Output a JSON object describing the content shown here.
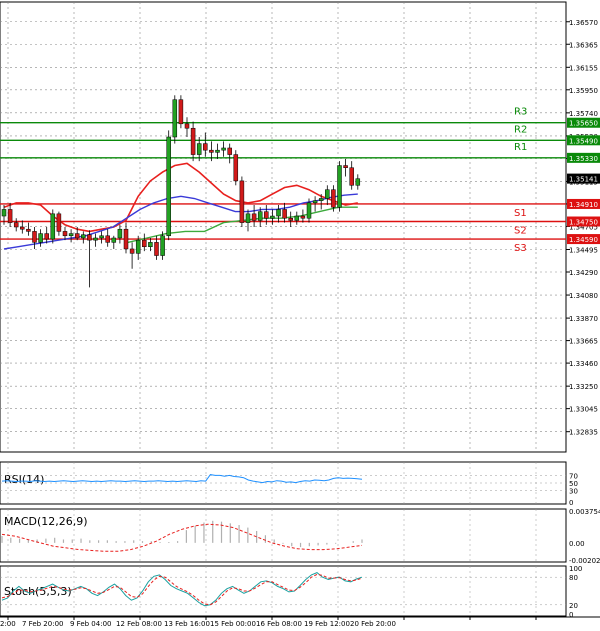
{
  "chart_data": {
    "type": "candlestick",
    "price_axis": {
      "ylim": [
        1.3265,
        1.3675
      ],
      "ticks": [
        "1.36570",
        "1.36365",
        "1.36155",
        "1.35950",
        "1.35740",
        "1.35530",
        "1.35325",
        "1.35115",
        "1.34910",
        "1.34705",
        "1.34495",
        "1.34290",
        "1.34080",
        "1.33870",
        "1.33665",
        "1.33460",
        "1.33250",
        "1.33045",
        "1.32835"
      ]
    },
    "x_tick_labels": [
      "2:00",
      "7 Feb 20:00",
      "9 Feb 04:00",
      "12 Feb 08:00",
      "13 Feb 16:00",
      "15 Feb 00:00",
      "16 Feb 08:00",
      "19 Feb 12:00",
      "20 Feb 20:00"
    ],
    "levels": [
      {
        "name": "R3",
        "value": "1.35650",
        "color": "#0a8a0a"
      },
      {
        "name": "R2",
        "value": "1.35490",
        "color": "#0a8a0a"
      },
      {
        "name": "R1",
        "value": "1.35330",
        "color": "#0a8a0a"
      },
      {
        "name": "S1",
        "value": "1.34910",
        "color": "#dd1111"
      },
      {
        "name": "S2",
        "value": "1.34750",
        "color": "#dd1111"
      },
      {
        "name": "S3",
        "value": "1.34590",
        "color": "#dd1111"
      }
    ],
    "current_price": "1.35141",
    "candles": [
      [
        1.348,
        1.349,
        1.3472,
        1.3486
      ],
      [
        1.3486,
        1.3492,
        1.347,
        1.3474
      ],
      [
        1.3474,
        1.3478,
        1.3466,
        1.347
      ],
      [
        1.347,
        1.3476,
        1.3464,
        1.3468
      ],
      [
        1.3468,
        1.3474,
        1.3462,
        1.3466
      ],
      [
        1.3466,
        1.347,
        1.345,
        1.3456
      ],
      [
        1.3456,
        1.3468,
        1.3452,
        1.3464
      ],
      [
        1.3464,
        1.347,
        1.3455,
        1.3459
      ],
      [
        1.3459,
        1.3486,
        1.3455,
        1.3482
      ],
      [
        1.3482,
        1.3484,
        1.3462,
        1.3466
      ],
      [
        1.3466,
        1.347,
        1.3458,
        1.3462
      ],
      [
        1.3462,
        1.3468,
        1.3456,
        1.3464
      ],
      [
        1.3464,
        1.347,
        1.3458,
        1.346
      ],
      [
        1.346,
        1.3466,
        1.3455,
        1.3463
      ],
      [
        1.3463,
        1.3467,
        1.3415,
        1.3458
      ],
      [
        1.3458,
        1.3464,
        1.3452,
        1.346
      ],
      [
        1.346,
        1.3466,
        1.3455,
        1.3462
      ],
      [
        1.3462,
        1.3468,
        1.3452,
        1.3456
      ],
      [
        1.3456,
        1.3462,
        1.345,
        1.346
      ],
      [
        1.346,
        1.3472,
        1.3455,
        1.3468
      ],
      [
        1.3468,
        1.3474,
        1.3446,
        1.345
      ],
      [
        1.345,
        1.3456,
        1.3432,
        1.3446
      ],
      [
        1.3446,
        1.3462,
        1.344,
        1.3458
      ],
      [
        1.3458,
        1.3464,
        1.3448,
        1.3452
      ],
      [
        1.3452,
        1.346,
        1.3448,
        1.3456
      ],
      [
        1.3456,
        1.3462,
        1.344,
        1.3444
      ],
      [
        1.3444,
        1.3466,
        1.344,
        1.3462
      ],
      [
        1.3462,
        1.3558,
        1.3458,
        1.3552
      ],
      [
        1.3552,
        1.359,
        1.3546,
        1.3586
      ],
      [
        1.3586,
        1.359,
        1.356,
        1.3564
      ],
      [
        1.3564,
        1.357,
        1.3552,
        1.356
      ],
      [
        1.356,
        1.3566,
        1.353,
        1.3536
      ],
      [
        1.3536,
        1.3552,
        1.353,
        1.3546
      ],
      [
        1.3546,
        1.3556,
        1.3534,
        1.354
      ],
      [
        1.354,
        1.3548,
        1.353,
        1.3538
      ],
      [
        1.3538,
        1.3546,
        1.3532,
        1.354
      ],
      [
        1.354,
        1.3548,
        1.3534,
        1.3542
      ],
      [
        1.3542,
        1.3546,
        1.3528,
        1.3536
      ],
      [
        1.3536,
        1.354,
        1.3508,
        1.3512
      ],
      [
        1.3512,
        1.3516,
        1.347,
        1.3474
      ],
      [
        1.3474,
        1.3486,
        1.3466,
        1.3482
      ],
      [
        1.3482,
        1.349,
        1.347,
        1.3476
      ],
      [
        1.3476,
        1.3488,
        1.347,
        1.3484
      ],
      [
        1.3484,
        1.349,
        1.3472,
        1.3478
      ],
      [
        1.3478,
        1.3486,
        1.3472,
        1.348
      ],
      [
        1.348,
        1.349,
        1.3474,
        1.3486
      ],
      [
        1.3486,
        1.3492,
        1.3474,
        1.3478
      ],
      [
        1.3478,
        1.3484,
        1.347,
        1.3476
      ],
      [
        1.3476,
        1.3484,
        1.3472,
        1.348
      ],
      [
        1.348,
        1.3486,
        1.3474,
        1.3478
      ],
      [
        1.3478,
        1.3496,
        1.3474,
        1.3492
      ],
      [
        1.3492,
        1.3498,
        1.3484,
        1.3494
      ],
      [
        1.3494,
        1.35,
        1.3486,
        1.3496
      ],
      [
        1.3496,
        1.3508,
        1.349,
        1.3504
      ],
      [
        1.3504,
        1.3508,
        1.3484,
        1.3488
      ],
      [
        1.3488,
        1.353,
        1.3484,
        1.3526
      ],
      [
        1.3526,
        1.3532,
        1.3516,
        1.3524
      ],
      [
        1.3524,
        1.353,
        1.3504,
        1.3508
      ],
      [
        1.3508,
        1.3518,
        1.3504,
        1.3514
      ]
    ],
    "moving_averages": [
      {
        "color": "#e8201e",
        "values": [
          1.3488,
          1.3492,
          1.3492,
          1.349,
          1.348,
          1.3472,
          1.3468,
          1.3466,
          1.3468,
          1.347,
          1.3476,
          1.3498,
          1.3512,
          1.352,
          1.3526,
          1.3528,
          1.352,
          1.351,
          1.35,
          1.3494,
          1.3492,
          1.3494,
          1.35,
          1.3506,
          1.3508,
          1.3504,
          1.3498,
          1.3494,
          1.349,
          1.3492
        ]
      },
      {
        "color": "#3a3ad8",
        "values": [
          1.345,
          1.3452,
          1.3454,
          1.3456,
          1.3458,
          1.346,
          1.3462,
          1.3466,
          1.347,
          1.3478,
          1.3486,
          1.3492,
          1.3496,
          1.3498,
          1.3496,
          1.3492,
          1.3488,
          1.3484,
          1.3484,
          1.3486,
          1.3486,
          1.3488,
          1.3492,
          1.3494,
          1.3497,
          1.3499,
          1.35
        ]
      },
      {
        "color": "#3caa3c",
        "values": [
          1.3456,
          1.346,
          1.3464,
          1.3466,
          1.3466,
          1.3474,
          1.3476,
          1.3478,
          1.3478,
          1.348,
          1.3484,
          1.3488,
          1.3488
        ]
      }
    ],
    "panels": [
      {
        "label": "RSI(14)",
        "ticks": [
          "70",
          "50",
          "30",
          "0"
        ],
        "range": [
          0,
          100
        ],
        "values": [
          55,
          56,
          55,
          54,
          55,
          55,
          54,
          56,
          55,
          54,
          55,
          54,
          55,
          56,
          55,
          54,
          55,
          56,
          55,
          54,
          55,
          54,
          55,
          56,
          55,
          55,
          54,
          55,
          56,
          55,
          54,
          55,
          55,
          56,
          55,
          54,
          55,
          54,
          55,
          56,
          55,
          54,
          56,
          55,
          72,
          70,
          70,
          68,
          70,
          67,
          66,
          64,
          58,
          55,
          53,
          51,
          54,
          53,
          56,
          55,
          52,
          53,
          51,
          54,
          56,
          55,
          58,
          57,
          56,
          58,
          62,
          64,
          62,
          63,
          62,
          61,
          60
        ]
      },
      {
        "label": "MACD(12,26,9)",
        "ticks": [
          "0.003754",
          "0.00",
          "-0.002021"
        ],
        "range": [
          -0.002021,
          0.003754
        ],
        "histogram": [
          0.0008,
          0.0006,
          0.0005,
          0.0004,
          0.0004,
          0.0005,
          0.0006,
          0.0004,
          0.0004,
          0.0005,
          0.0003,
          0.0003,
          0.0003,
          0.0002,
          0.0002,
          0.0003,
          0.0002,
          0.0002,
          0.0001,
          0.0001,
          0.0002,
          0.0015,
          0.002,
          0.0024,
          0.0026,
          0.0025,
          0.0023,
          0.0021,
          0.0018,
          0.0014,
          0.0009,
          0.0004,
          -0.0001,
          -0.0004,
          -0.0005,
          -0.0004,
          -0.0003,
          -0.0002,
          -0.0001,
          0.0,
          0.0002,
          0.0004
        ],
        "signal": [
          0.001,
          0.0008,
          0.0004,
          0.0,
          -0.0004,
          -0.0006,
          -0.0008,
          -0.0009,
          -0.001,
          -0.001,
          -0.0008,
          -0.0004,
          0.0002,
          0.001,
          0.0016,
          0.002,
          0.0022,
          0.0021,
          0.0018,
          0.0012,
          0.0006,
          0.0,
          -0.0004,
          -0.0007,
          -0.0008,
          -0.0008,
          -0.0007,
          -0.0005,
          -0.0003
        ]
      },
      {
        "label": "Stoch(5,5,3)",
        "ticks": [
          "100",
          "80",
          "20",
          "0"
        ],
        "range": [
          0,
          100
        ],
        "k": [
          30,
          35,
          50,
          60,
          50,
          45,
          50,
          55,
          60,
          65,
          58,
          52,
          50,
          55,
          60,
          55,
          45,
          40,
          48,
          58,
          65,
          55,
          40,
          30,
          35,
          50,
          70,
          82,
          85,
          75,
          62,
          55,
          50,
          45,
          35,
          25,
          18,
          20,
          30,
          45,
          55,
          60,
          52,
          45,
          50,
          60,
          70,
          72,
          68,
          60,
          55,
          48,
          50,
          62,
          75,
          85,
          90,
          80,
          75,
          78,
          80,
          72,
          70,
          76,
          80
        ],
        "d": [
          35,
          38,
          45,
          52,
          52,
          48,
          50,
          52,
          56,
          60,
          58,
          54,
          52,
          54,
          57,
          55,
          50,
          45,
          47,
          53,
          60,
          58,
          48,
          38,
          36,
          44,
          60,
          74,
          82,
          80,
          70,
          60,
          54,
          48,
          40,
          30,
          22,
          20,
          26,
          38,
          50,
          57,
          55,
          50,
          50,
          56,
          64,
          70,
          70,
          64,
          58,
          52,
          51,
          58,
          68,
          80,
          86,
          84,
          78,
          78,
          79,
          75,
          72,
          74,
          78
        ]
      }
    ]
  }
}
